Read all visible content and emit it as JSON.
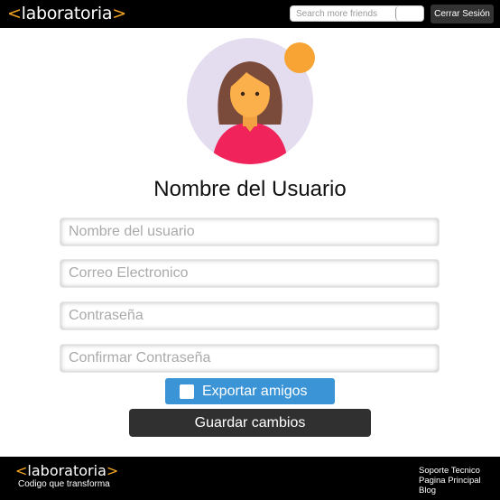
{
  "header": {
    "logo_prefix": "<",
    "logo_text": "laboratoria",
    "logo_suffix": ">",
    "search_placeholder": "Search more friends",
    "logout_label": "Cerrar Sesión"
  },
  "profile": {
    "username": "Nombre del Usuario",
    "notification_color": "#f7a435"
  },
  "form": {
    "username_placeholder": "Nombre del usuario",
    "email_placeholder": "Correo Electronico",
    "password_placeholder": "Contraseña",
    "confirm_password_placeholder": "Confirmar Contraseña",
    "export_label": "Exportar amigos",
    "save_label": "Guardar cambios"
  },
  "footer": {
    "logo_prefix": "<",
    "logo_text": "laboratoria",
    "logo_suffix": ">",
    "tagline": "Codigo que transforma",
    "links": [
      "Soporte Tecnico",
      "Pagina Principal",
      "Blog"
    ]
  },
  "colors": {
    "accent_blue": "#3a94d6",
    "brand_orange": "#f5a623",
    "dark_button": "#303030"
  }
}
